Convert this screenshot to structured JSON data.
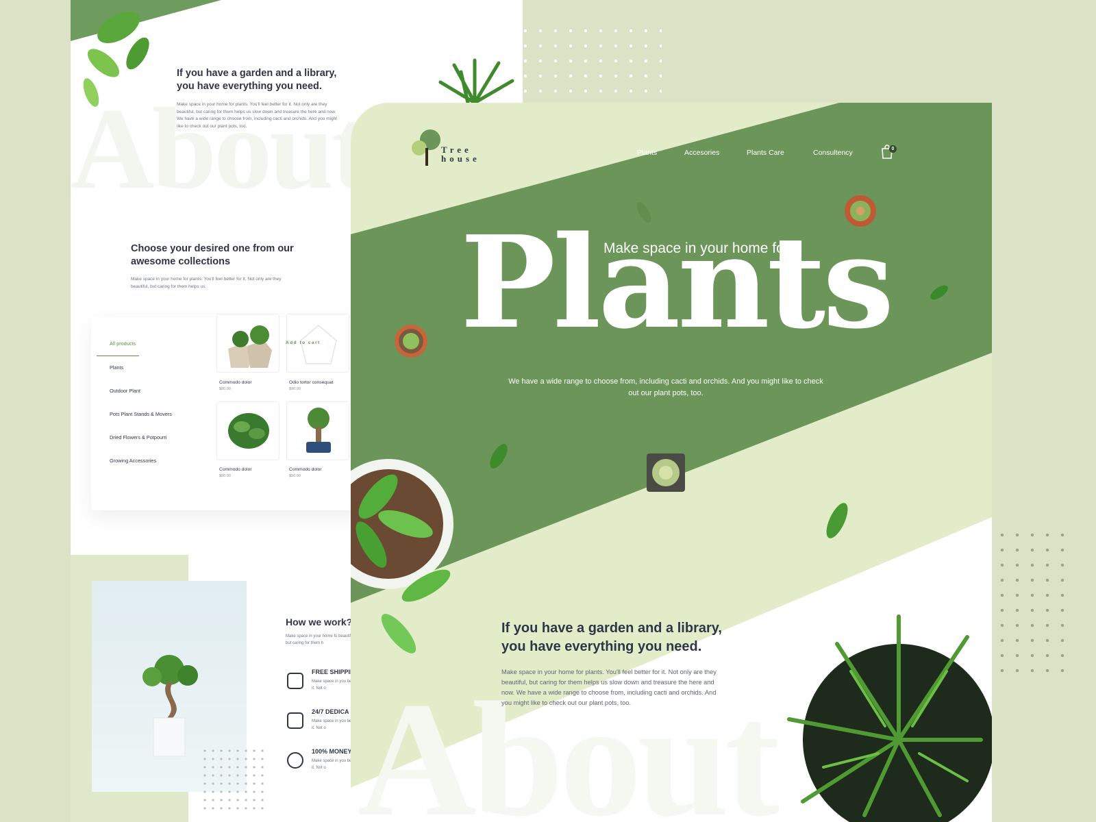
{
  "colors": {
    "background": "#dbe2c6",
    "brand_green": "#6b9559",
    "light_green": "#e3ecc9",
    "text_dark": "#2c3646"
  },
  "back_page": {
    "about_heading": "If you have a garden and a library, you have everything you need.",
    "about_text": "Make space in your home for plants. You'll feel better for it. Not only are they beautiful, but caring for them helps us slow down and treasure the here and now. We have a wide range to choose from, including cacti and orchids. And you might like to check out our plant pots, too.",
    "about_watermark": "About",
    "collections_heading": "Choose your desired one from our awesome collections",
    "collections_text": "Make space in your home for plants. You'll feel better for it. Not only are they beautiful, but caring for them helps us.",
    "categories": [
      "All products",
      "Plants",
      "Outdoor Plant",
      "Pots Plant Stands & Movers",
      "Dried Flowers & Potpourri",
      "Growing Accessories"
    ],
    "add_to_cart": "Add to cart",
    "products": [
      {
        "name": "Commodo dolor",
        "price": "$80.00"
      },
      {
        "name": "Odio tortor consequat",
        "price": "$90.00"
      },
      {
        "name": "Commodo dolor",
        "price": "$80.00"
      },
      {
        "name": "Commodo dolor",
        "price": "$50.00"
      }
    ],
    "how_title": "How we work?",
    "how_text": "Make space in your home fo beautiful, but caring for them h",
    "features": [
      {
        "icon": "truck-icon",
        "title": "FREE SHIPPIN",
        "text": "Make space in you better for it. Not o"
      },
      {
        "icon": "support-icon",
        "title": "24/7 DEDICA",
        "text": "Make space in you better for it. Not o"
      },
      {
        "icon": "money-icon",
        "title": "100% MONEY",
        "text": "Make space in you better for it. Not o"
      }
    ]
  },
  "main_page": {
    "logo": {
      "line1": "Tree",
      "line2": "house"
    },
    "nav": [
      "Plants",
      "Accesories",
      "Plants Care",
      "Consultency"
    ],
    "cart_count": "0",
    "hero_subtitle": "Make space in your home for",
    "hero_title": "Plants",
    "hero_text": "We have a wide range to choose from, including cacti and orchids. And you might like to check out our plant pots, too.",
    "about_heading": "If you have a garden and a library, you have everything you need.",
    "about_text": "Make space in your home for plants. You'll feel better for it. Not only are they beautiful, but caring for them helps us slow down and treasure the here and now. We have a wide range to choose from, including cacti and orchids. And you might like to check out our plant pots, too.",
    "about_watermark": "About"
  }
}
